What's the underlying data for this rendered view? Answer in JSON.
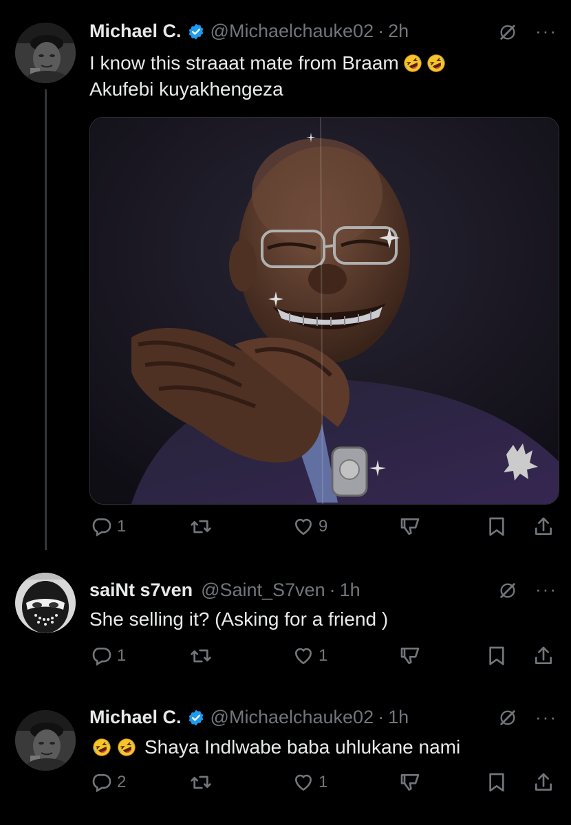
{
  "tweets": [
    {
      "name": "Michael C.",
      "handle": "@Michaelchauke02",
      "time": "2h",
      "text_line1": "I know this straaat mate from Braam",
      "text_line2": "Akufebi kuyakhengeza",
      "replies": "1",
      "retweets": "",
      "likes": "9"
    },
    {
      "name": "saiNt s7ven",
      "handle": "@Saint_S7ven",
      "time": "1h",
      "text_line1": "She selling it? (Asking for a friend )",
      "replies": "1",
      "retweets": "",
      "likes": "1"
    },
    {
      "name": "Michael C.",
      "handle": "@Michaelchauke02",
      "time": "1h",
      "text_line1": "Shaya Indlwabe baba uhlukane nami",
      "replies": "2",
      "retweets": "",
      "likes": "1"
    }
  ],
  "separator": "·",
  "colors": {
    "background": "#000000",
    "muted": "#71767b",
    "verified": "#1d9bf0",
    "text": "#e7e9ea"
  },
  "icons": [
    "verified-badge-icon",
    "grok-icon",
    "more-icon",
    "reply-icon",
    "retweet-icon",
    "like-icon",
    "dislike-icon",
    "bookmark-icon",
    "share-icon",
    "rofl-emoji"
  ]
}
